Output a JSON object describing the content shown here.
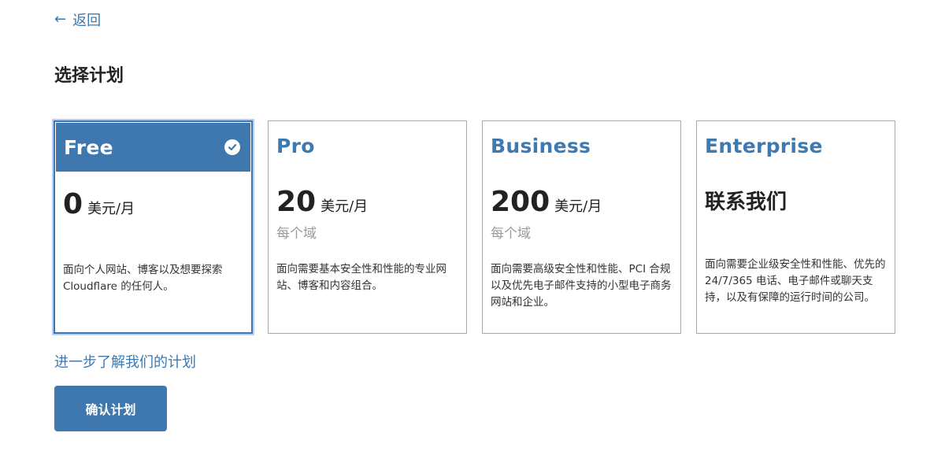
{
  "nav": {
    "back_icon": "arrow-left-icon",
    "back_label": "返回"
  },
  "page_title": "选择计划",
  "plans": [
    {
      "name": "Free",
      "selected": true,
      "price": "0",
      "unit": "美元/月",
      "per_domain": "",
      "description": "面向个人网站、博客以及想要探索 Cloudflare 的任何人。",
      "icon": "check-circle-icon"
    },
    {
      "name": "Pro",
      "selected": false,
      "price": "20",
      "unit": "美元/月",
      "per_domain": "每个域",
      "description": "面向需要基本安全性和性能的专业网站、博客和内容组合。"
    },
    {
      "name": "Business",
      "selected": false,
      "price": "200",
      "unit": "美元/月",
      "per_domain": "每个域",
      "description": "面向需要高级安全性和性能、PCI 合规以及优先电子邮件支持的小型电子商务网站和企业。"
    },
    {
      "name": "Enterprise",
      "selected": false,
      "contact": "联系我们",
      "description": "面向需要企业级安全性和性能、优先的 24/7/365 电话、电子邮件或聊天支持，以及有保障的运行时间的公司。"
    }
  ],
  "learn_more_label": "进一步了解我们的计划",
  "confirm_label": "确认计划",
  "colors": {
    "accent": "#3f78ae",
    "link": "#3d78b0",
    "selected_outline": "#b9cdf7",
    "muted": "#9a9a9a"
  }
}
